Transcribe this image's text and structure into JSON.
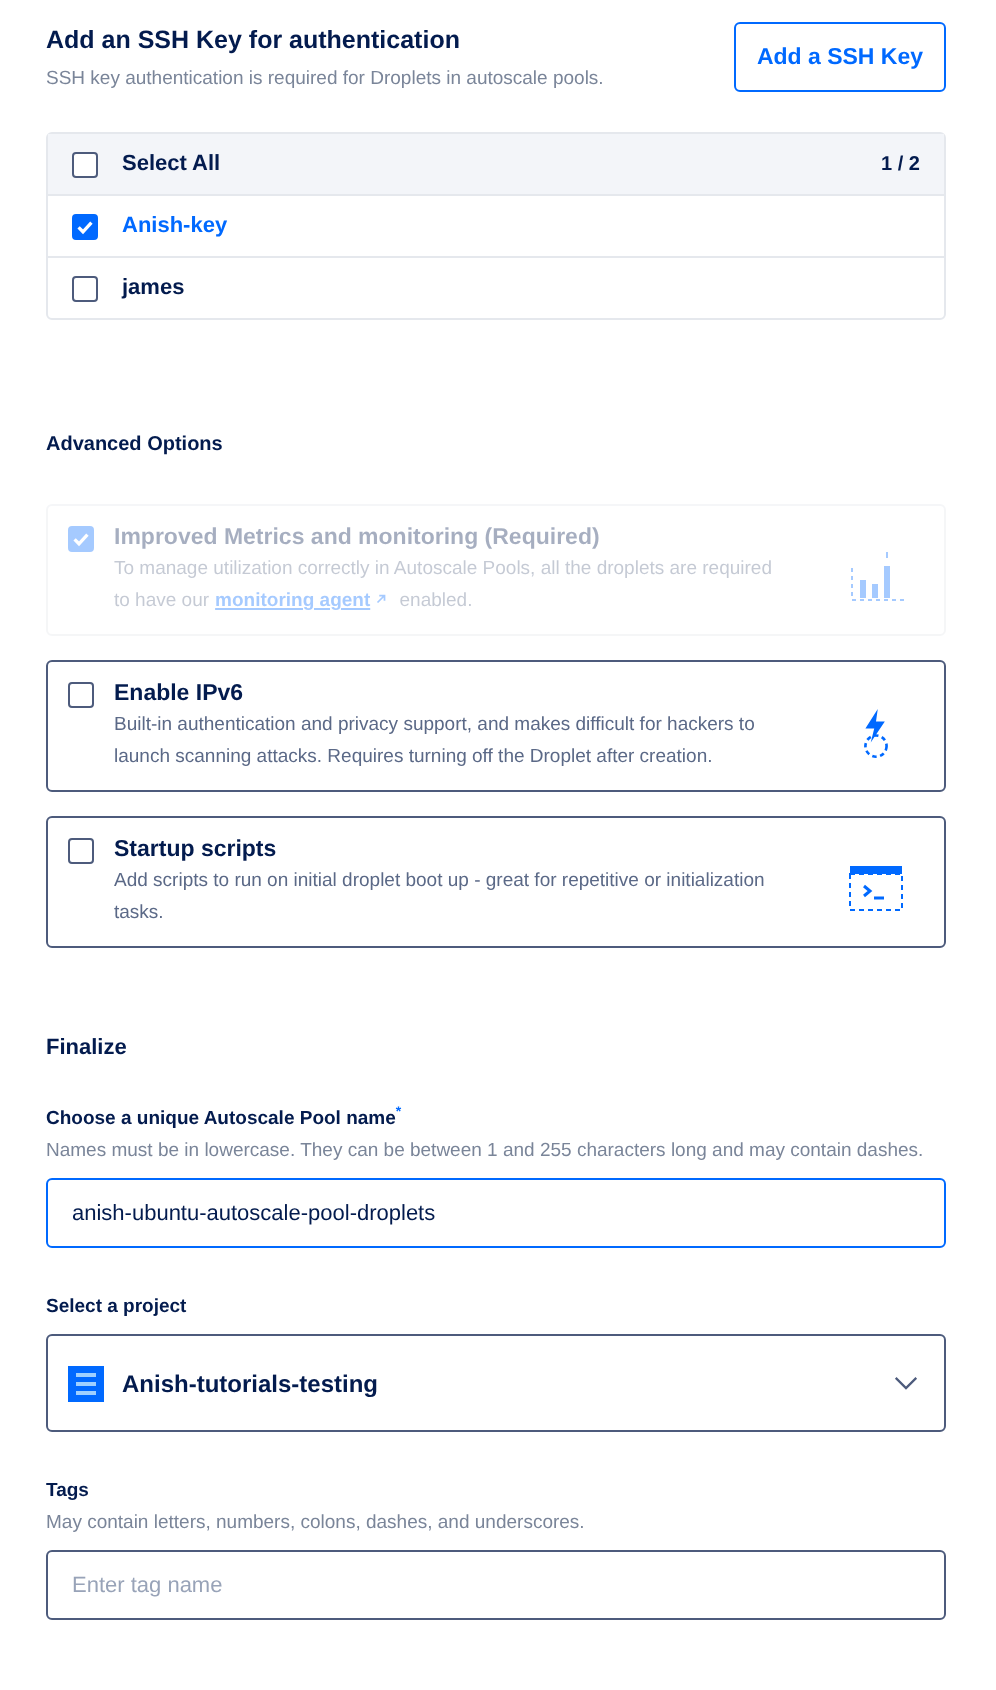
{
  "ssh": {
    "title": "Add an SSH Key for authentication",
    "subtitle": "SSH key authentication is required for Droplets in autoscale pools.",
    "add_button": "Add a SSH Key",
    "select_all": {
      "label": "Select All",
      "checked": false,
      "count": "1 / 2"
    },
    "keys": [
      {
        "name": "Anish-key",
        "checked": true
      },
      {
        "name": "james",
        "checked": false
      }
    ]
  },
  "advanced": {
    "title": "Advanced Options",
    "options": [
      {
        "kind": "metrics",
        "title": "Improved Metrics and monitoring (Required)",
        "checked": true,
        "disabled": true,
        "description": "To manage utilization correctly in Autoscale Pools, all the droplets are required to have our",
        "link": "monitoring agent",
        "description_end": "enabled."
      },
      {
        "kind": "ipv6",
        "title": "Enable IPv6",
        "checked": false,
        "disabled": false,
        "description": "Built-in authentication and privacy support, and makes difficult for hackers to launch scanning attacks. Requires turning off the Droplet after creation."
      },
      {
        "kind": "scripts",
        "title": "Startup scripts",
        "checked": false,
        "disabled": false,
        "description": "Add scripts to run on initial droplet boot up - great for repetitive or initialization tasks."
      }
    ]
  },
  "finalize": {
    "title": "Finalize",
    "name_label": "Choose a unique Autoscale Pool name$^{*}$",
    "name_hint": "Names must be in lowercase. They can be between 1 and 255 characters long and may contain dashes.",
    "name_value": "anish-ubuntu-autoscale-pool-droplets",
    "project_label": "Select a project",
    "project_value": "Anish-tutorials-testing",
    "tags_label": "Tags",
    "tags_hint": "May contain letters, numbers, colons, dashes, and underscores.",
    "tags_placeholder": "Enter tag name"
  }
}
